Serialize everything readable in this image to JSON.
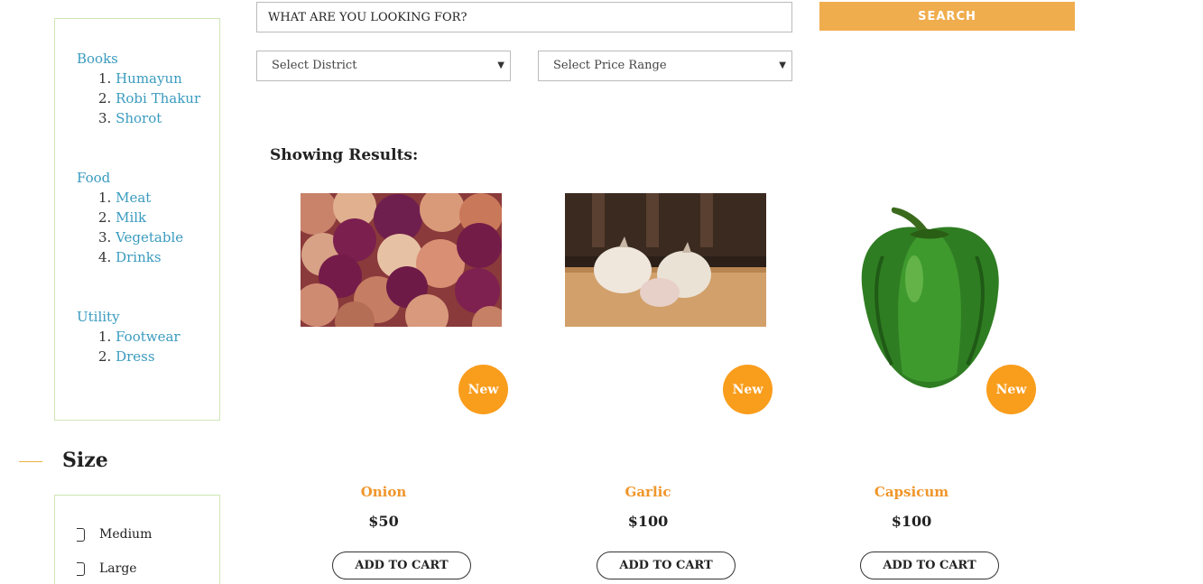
{
  "sidebar": {
    "categories": [
      {
        "title": "Books",
        "items": [
          {
            "num": "1.",
            "label": "Humayun"
          },
          {
            "num": "2.",
            "label": "Robi Thakur"
          },
          {
            "num": "3.",
            "label": "Shorot"
          }
        ]
      },
      {
        "title": "Food",
        "items": [
          {
            "num": "1.",
            "label": "Meat"
          },
          {
            "num": "2.",
            "label": "Milk"
          },
          {
            "num": "3.",
            "label": "Vegetable"
          },
          {
            "num": "4.",
            "label": "Drinks"
          }
        ]
      },
      {
        "title": "Utility",
        "items": [
          {
            "num": "1.",
            "label": "Footwear"
          },
          {
            "num": "2.",
            "label": "Dress"
          }
        ]
      }
    ],
    "size": {
      "title": "Size",
      "options": [
        "Medium",
        "Large"
      ]
    }
  },
  "search": {
    "value": "WHAT ARE YOU LOOKING FOR?",
    "button": "SEARCH",
    "district_select": "Select District",
    "price_select": "Select Price Range"
  },
  "results": {
    "title": "Showing Results:",
    "products": [
      {
        "name": "Onion",
        "price": "$50",
        "badge": "New",
        "button": "ADD TO CART"
      },
      {
        "name": "Garlic",
        "price": "$100",
        "badge": "New",
        "button": "ADD TO CART"
      },
      {
        "name": "Capsicum",
        "price": "$100",
        "badge": "New",
        "button": "ADD TO CART"
      }
    ]
  },
  "colors": {
    "accent": "#f0ad4e",
    "badge": "#f99d1c",
    "link": "#3a9bbf",
    "border": "#cfe5b5"
  }
}
